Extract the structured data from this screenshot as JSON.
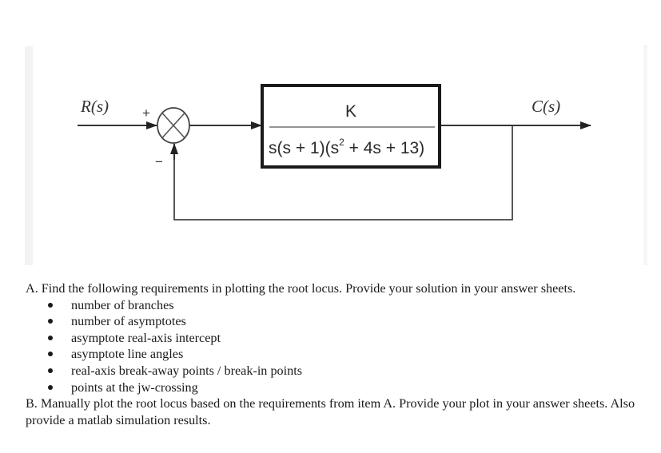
{
  "diagram": {
    "input_label": "R(s)",
    "output_label": "C(s)",
    "sum_plus_sign": "+",
    "sum_minus_sign": "−",
    "block": {
      "numerator": "K",
      "denominator_part1": "s(s + 1)(s",
      "denominator_superscript": "2",
      "denominator_part2": " + 4s + 13)"
    },
    "feedback": "unity negative feedback"
  },
  "question": {
    "part_a": {
      "text": "A. Find the following requirements in plotting the root locus. Provide your solution in your answer sheets.",
      "items": [
        "number of branches",
        "number of asymptotes",
        "asymptote real-axis intercept",
        "asymptote line angles",
        "real-axis break-away points / break-in points",
        "points at the jw-crossing"
      ]
    },
    "part_b": {
      "text": "B. Manually plot the root locus based on the requirements from item A. Provide your plot in your answer sheets. Also provide a matlab simulation results."
    }
  }
}
